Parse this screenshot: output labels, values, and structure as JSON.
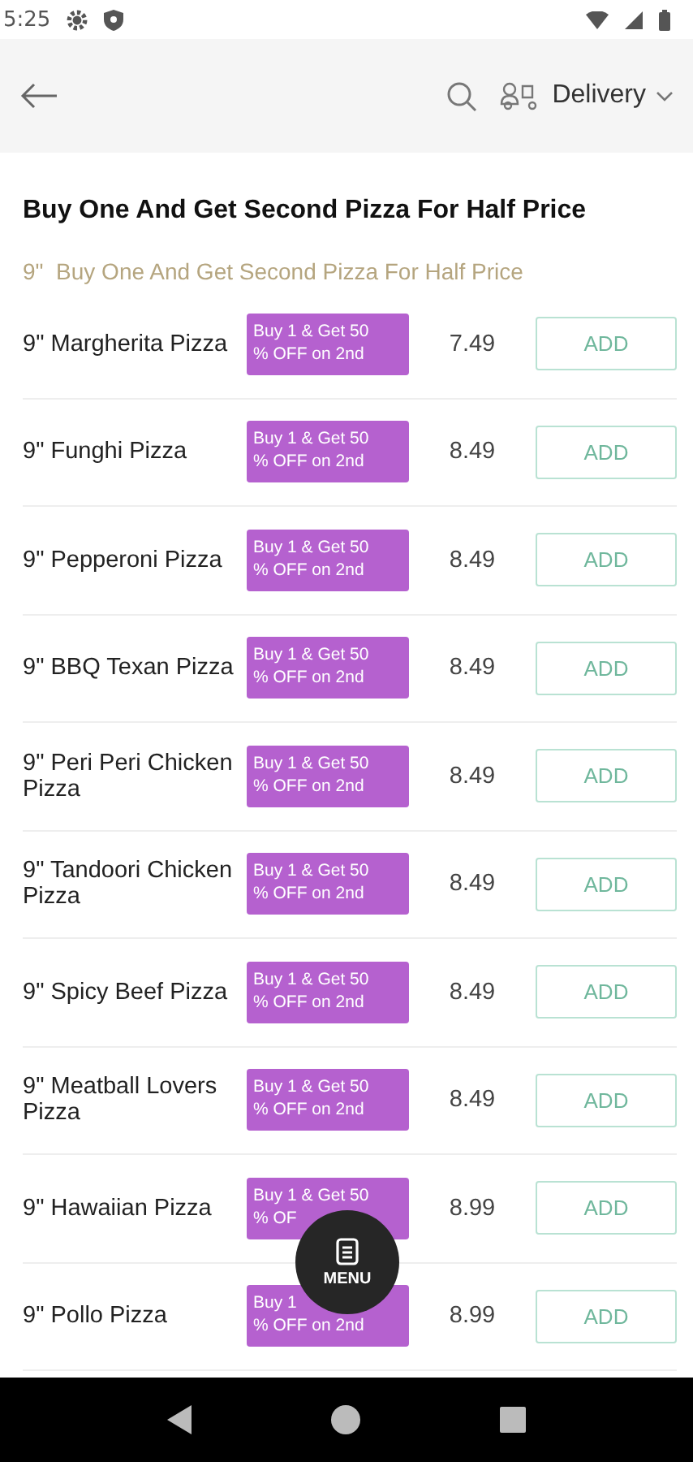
{
  "status_bar": {
    "time": "5:25"
  },
  "header": {
    "delivery": {
      "label": "Delivery"
    }
  },
  "section": {
    "title": "Buy One And Get Second Pizza For Half Price",
    "subtitle": "9\"  Buy One And Get Second Pizza For Half Price"
  },
  "items": [
    {
      "name": "9\" Margherita Pizza",
      "badge": [
        "Buy 1 & Get 50",
        "% OFF on 2nd"
      ],
      "price": "7.49",
      "button": "ADD"
    },
    {
      "name": "9\" Funghi Pizza",
      "badge": [
        "Buy 1 & Get 50",
        "% OFF on 2nd"
      ],
      "price": "8.49",
      "button": "ADD"
    },
    {
      "name": "9\" Pepperoni Pizza",
      "badge": [
        "Buy 1 & Get 50",
        "% OFF on 2nd"
      ],
      "price": "8.49",
      "button": "ADD"
    },
    {
      "name": "9\" BBQ Texan Pizza",
      "badge": [
        "Buy 1 & Get 50",
        "% OFF on 2nd"
      ],
      "price": "8.49",
      "button": "ADD"
    },
    {
      "name": "9\" Peri Peri Chicken Pizza",
      "badge": [
        "Buy 1 & Get 50",
        "% OFF on 2nd"
      ],
      "price": "8.49",
      "button": "ADD"
    },
    {
      "name": "9\" Tandoori Chicken Pizza",
      "badge": [
        "Buy 1 & Get 50",
        "% OFF on 2nd"
      ],
      "price": "8.49",
      "button": "ADD"
    },
    {
      "name": "9\" Spicy Beef Pizza",
      "badge": [
        "Buy 1 & Get 50",
        "% OFF on 2nd"
      ],
      "price": "8.49",
      "button": "ADD"
    },
    {
      "name": "9\" Meatball Lovers Pizza",
      "badge": [
        "Buy 1 & Get 50",
        "% OFF on 2nd"
      ],
      "price": "8.49",
      "button": "ADD"
    },
    {
      "name": "9\" Hawaiian Pizza",
      "badge": [
        "Buy 1 & Get 50",
        "% OF"
      ],
      "price": "8.99",
      "button": "ADD"
    },
    {
      "name": "9\" Pollo Pizza",
      "badge": [
        "Buy 1",
        "% OFF on 2nd"
      ],
      "price": "8.99",
      "button": "ADD"
    }
  ],
  "menu_button": {
    "label": "MENU"
  }
}
